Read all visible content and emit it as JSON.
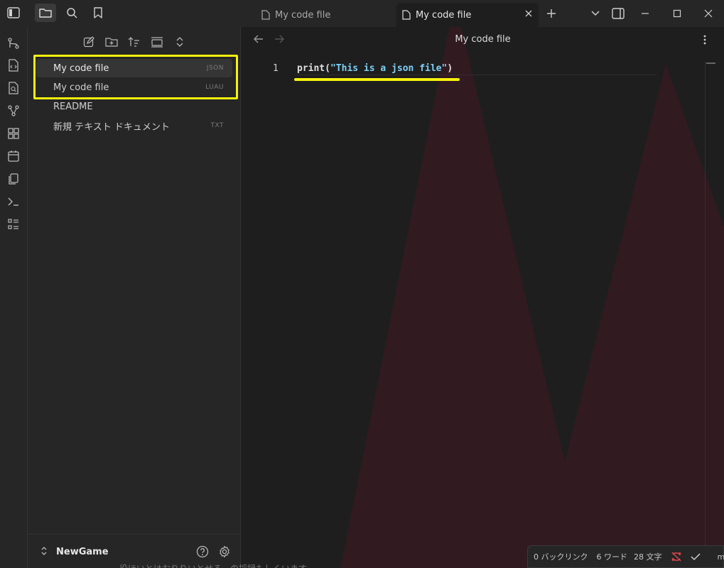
{
  "titlebar": {
    "tabs": [
      {
        "label": "My code file",
        "active": false
      },
      {
        "label": "My code file",
        "active": true
      }
    ]
  },
  "ribbon": {
    "icons": [
      "git-branch-icon",
      "code-file-icon",
      "file-search-icon",
      "graph-icon",
      "grid-icon",
      "calendar-icon",
      "copy-icon",
      "terminal-icon",
      "list-icon"
    ]
  },
  "sidebar": {
    "files": [
      {
        "name": "My code file",
        "ext": "JSON",
        "active": true
      },
      {
        "name": "My code file",
        "ext": "LUAU",
        "active": false
      },
      {
        "name": "README",
        "ext": "",
        "active": false
      },
      {
        "name": "新規 テキスト ドキュメント",
        "ext": "TXT",
        "active": false
      }
    ],
    "vault_name": "NewGame"
  },
  "editor": {
    "view_title": "My code file",
    "line_number": "1",
    "code": {
      "fn": "print(",
      "str": "\"This is a json file\"",
      "close": ")"
    }
  },
  "status": {
    "backlinks": "0 バックリンク",
    "words": "6 ワード",
    "chars": "28 文字",
    "branch": "main"
  },
  "bleed_text": "役ほいとはおりりいとせる…の採録もしくいます",
  "colors": {
    "highlight": "#f5f10d",
    "string": "#7ed0f7",
    "accent_bg": "#4a1f2a",
    "sync_error": "#e0464e"
  }
}
